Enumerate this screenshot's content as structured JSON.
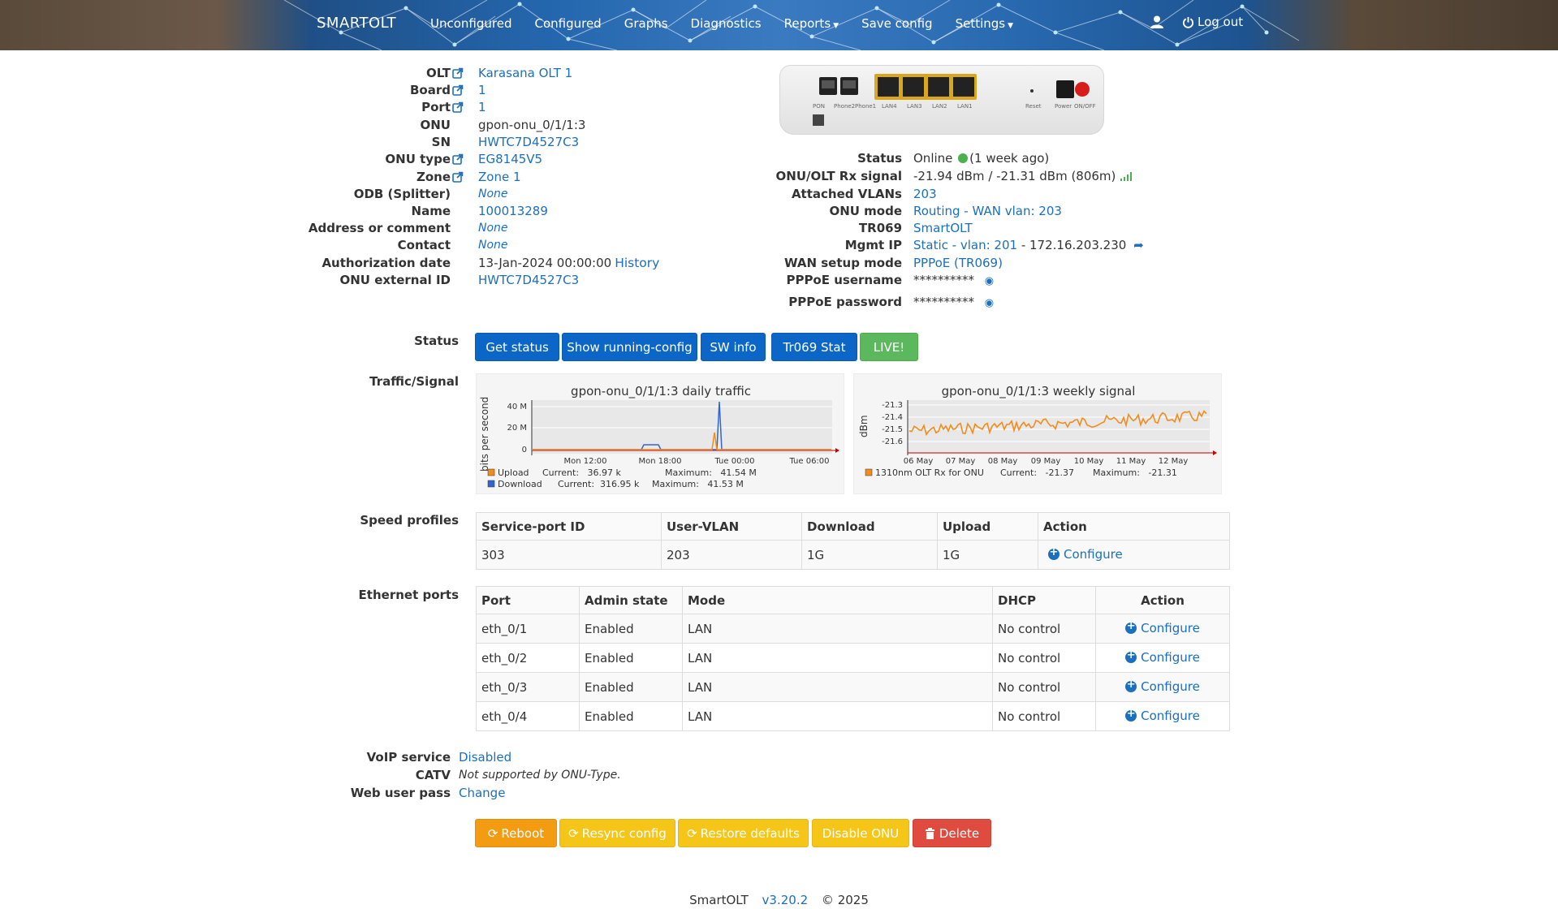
{
  "nav": {
    "brand": "SMARTOLT",
    "items": [
      "Unconfigured",
      "Configured",
      "Graphs",
      "Diagnostics",
      "Reports",
      "Save config",
      "Settings"
    ],
    "logout": "Log out"
  },
  "info_left": [
    {
      "key": "OLT",
      "value": "Karasana OLT 1",
      "link": true,
      "icon": true
    },
    {
      "key": "Board",
      "value": "1",
      "link": true,
      "icon": true
    },
    {
      "key": "Port",
      "value": "1",
      "link": true,
      "icon": true
    },
    {
      "key": "ONU",
      "value": "gpon-onu_0/1/1:3",
      "link": false,
      "icon": false
    },
    {
      "key": "SN",
      "value": "HWTC7D4527C3",
      "link": true,
      "icon": false
    },
    {
      "key": "ONU type",
      "value": "EG8145V5",
      "link": true,
      "icon": true
    },
    {
      "key": "Zone",
      "value": "Zone 1",
      "link": true,
      "icon": true
    },
    {
      "key": "ODB (Splitter)",
      "value": "None",
      "link": true,
      "icon": false,
      "italic": true
    },
    {
      "key": "Name",
      "value": "100013289",
      "link": true,
      "icon": false
    },
    {
      "key": "Address or comment",
      "value": "None",
      "link": true,
      "icon": false,
      "italic": true
    },
    {
      "key": "Contact",
      "value": "None",
      "link": true,
      "icon": false,
      "italic": true
    },
    {
      "key": "Authorization date",
      "value": "13-Jan-2024 00:00:00",
      "link": false,
      "icon": false,
      "extra": "History"
    },
    {
      "key": "ONU external ID",
      "value": "HWTC7D4527C3",
      "link": true,
      "icon": false
    }
  ],
  "device_labels": {
    "pon": "PON",
    "phone2": "Phone2",
    "phone1": "Phone1",
    "lan4": "LAN4",
    "lan3": "LAN3",
    "lan2": "LAN2",
    "lan1": "LAN1",
    "reset": "Reset",
    "power": "Power",
    "onoff": "ON/OFF"
  },
  "info_right": {
    "status_key": "Status",
    "status_value": "Online",
    "status_age": "(1 week ago)",
    "rx_key": "ONU/OLT Rx signal",
    "rx_value": "-21.94 dBm / -21.31 dBm (806m)",
    "vlans_key": "Attached VLANs",
    "vlans_value": "203",
    "mode_key": "ONU mode",
    "mode_value": "Routing - WAN vlan: 203",
    "tr069_key": "TR069",
    "tr069_value": "SmartOLT",
    "mgmt_key": "Mgmt IP",
    "mgmt_link": "Static - vlan: 201",
    "mgmt_ip": " - 172.16.203.230",
    "wan_key": "WAN setup mode",
    "wan_value": "PPPoE (TR069)",
    "pppoe_user_key": "PPPoE username",
    "pppoe_user_value": "**********",
    "pppoe_pass_key": "PPPoE password",
    "pppoe_pass_value": "**********"
  },
  "status_section": {
    "label": "Status",
    "buttons": [
      "Get status",
      "Show running-config",
      "SW info",
      "Tr069 Stat",
      "LIVE!"
    ]
  },
  "traffic": {
    "label": "Traffic/Signal",
    "traffic_title": "gpon-onu_0/1/1:3 daily traffic",
    "traffic_ylabel": "bits per second",
    "traffic_yticks": [
      "40 M",
      "20 M",
      "0"
    ],
    "traffic_xticks": [
      "Mon 12:00",
      "Mon 18:00",
      "Tue 00:00",
      "Tue 06:00"
    ],
    "upload_label": "Upload",
    "upload_current": "Current:   36.97 k",
    "upload_max": "Maximum:   41.54 M",
    "download_label": "Download",
    "download_current": "Current:  316.95 k",
    "download_max": "Maximum:   41.53 M",
    "signal_title": "gpon-onu_0/1/1:3 weekly signal",
    "signal_ylabel": "dBm",
    "signal_yticks": [
      "-21.3",
      "-21.4",
      "-21.5",
      "-21.6"
    ],
    "signal_xticks": [
      "06 May",
      "07 May",
      "08 May",
      "09 May",
      "10 May",
      "11 May",
      "12 May"
    ],
    "signal_legend": "1310nm OLT Rx for ONU",
    "signal_current": "Current:   -21.37",
    "signal_max": "Maximum:   -21.31",
    "colors": {
      "upload": "#f28c1c",
      "download": "#3366cc",
      "signal": "#f28c1c"
    }
  },
  "speed_profiles": {
    "label": "Speed profiles",
    "headers": [
      "Service-port ID",
      "User-VLAN",
      "Download",
      "Upload",
      "Action"
    ],
    "rows": [
      [
        "303",
        "203",
        "1G",
        "1G",
        "Configure"
      ]
    ]
  },
  "ethernet_ports": {
    "label": "Ethernet ports",
    "headers": [
      "Port",
      "Admin state",
      "Mode",
      "DHCP",
      "Action"
    ],
    "rows": [
      [
        "eth_0/1",
        "Enabled",
        "LAN",
        "No control",
        "Configure"
      ],
      [
        "eth_0/2",
        "Enabled",
        "LAN",
        "No control",
        "Configure"
      ],
      [
        "eth_0/3",
        "Enabled",
        "LAN",
        "No control",
        "Configure"
      ],
      [
        "eth_0/4",
        "Enabled",
        "LAN",
        "No control",
        "Configure"
      ]
    ]
  },
  "extra": {
    "voip_key": "VoIP service",
    "voip_value": "Disabled",
    "catv_key": "CATV",
    "catv_value": "Not supported by ONU-Type.",
    "webpass_key": "Web user pass",
    "webpass_value": "Change"
  },
  "actions": [
    "Reboot",
    "Resync config",
    "Restore defaults",
    "Disable ONU",
    "Delete"
  ],
  "footer": {
    "app": "SmartOLT",
    "version": "v3.20.2",
    "copyright": "© 2025"
  }
}
